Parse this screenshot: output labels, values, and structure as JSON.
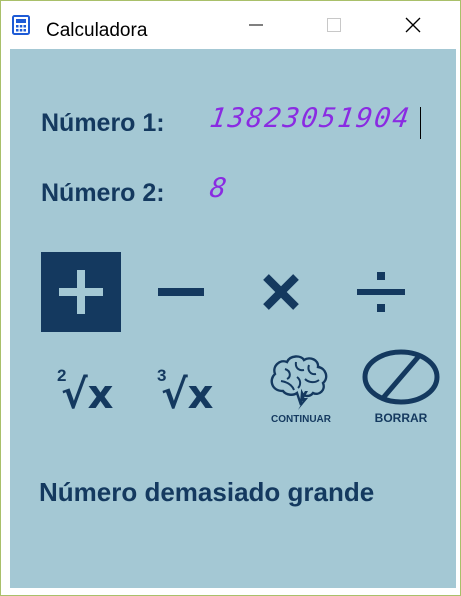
{
  "window": {
    "title": "Calculadora",
    "icon": "calculator-icon",
    "controls": [
      "minimize-icon",
      "maximize-icon",
      "close-icon"
    ]
  },
  "form": {
    "number1_label": "Número 1:",
    "number1_value": "13823051904",
    "number2_label": "Número 2:",
    "number2_value": "8"
  },
  "operations": [
    {
      "name": "add",
      "icon": "plus-icon",
      "selected": true
    },
    {
      "name": "subtract",
      "icon": "minus-icon",
      "selected": false
    },
    {
      "name": "multiply",
      "icon": "multiply-icon",
      "selected": false
    },
    {
      "name": "divide",
      "icon": "divide-icon",
      "selected": false
    }
  ],
  "functions": {
    "square_root_index": "2",
    "cube_root_index": "3",
    "root_symbol": "√x",
    "continue_label": "CONTINUAR",
    "clear_label": "BORRAR"
  },
  "status": {
    "message": "Número demasiado grande"
  },
  "colors": {
    "background": "#a4c8d4",
    "accent": "#14395f",
    "lcd_text": "#8a2be2"
  }
}
